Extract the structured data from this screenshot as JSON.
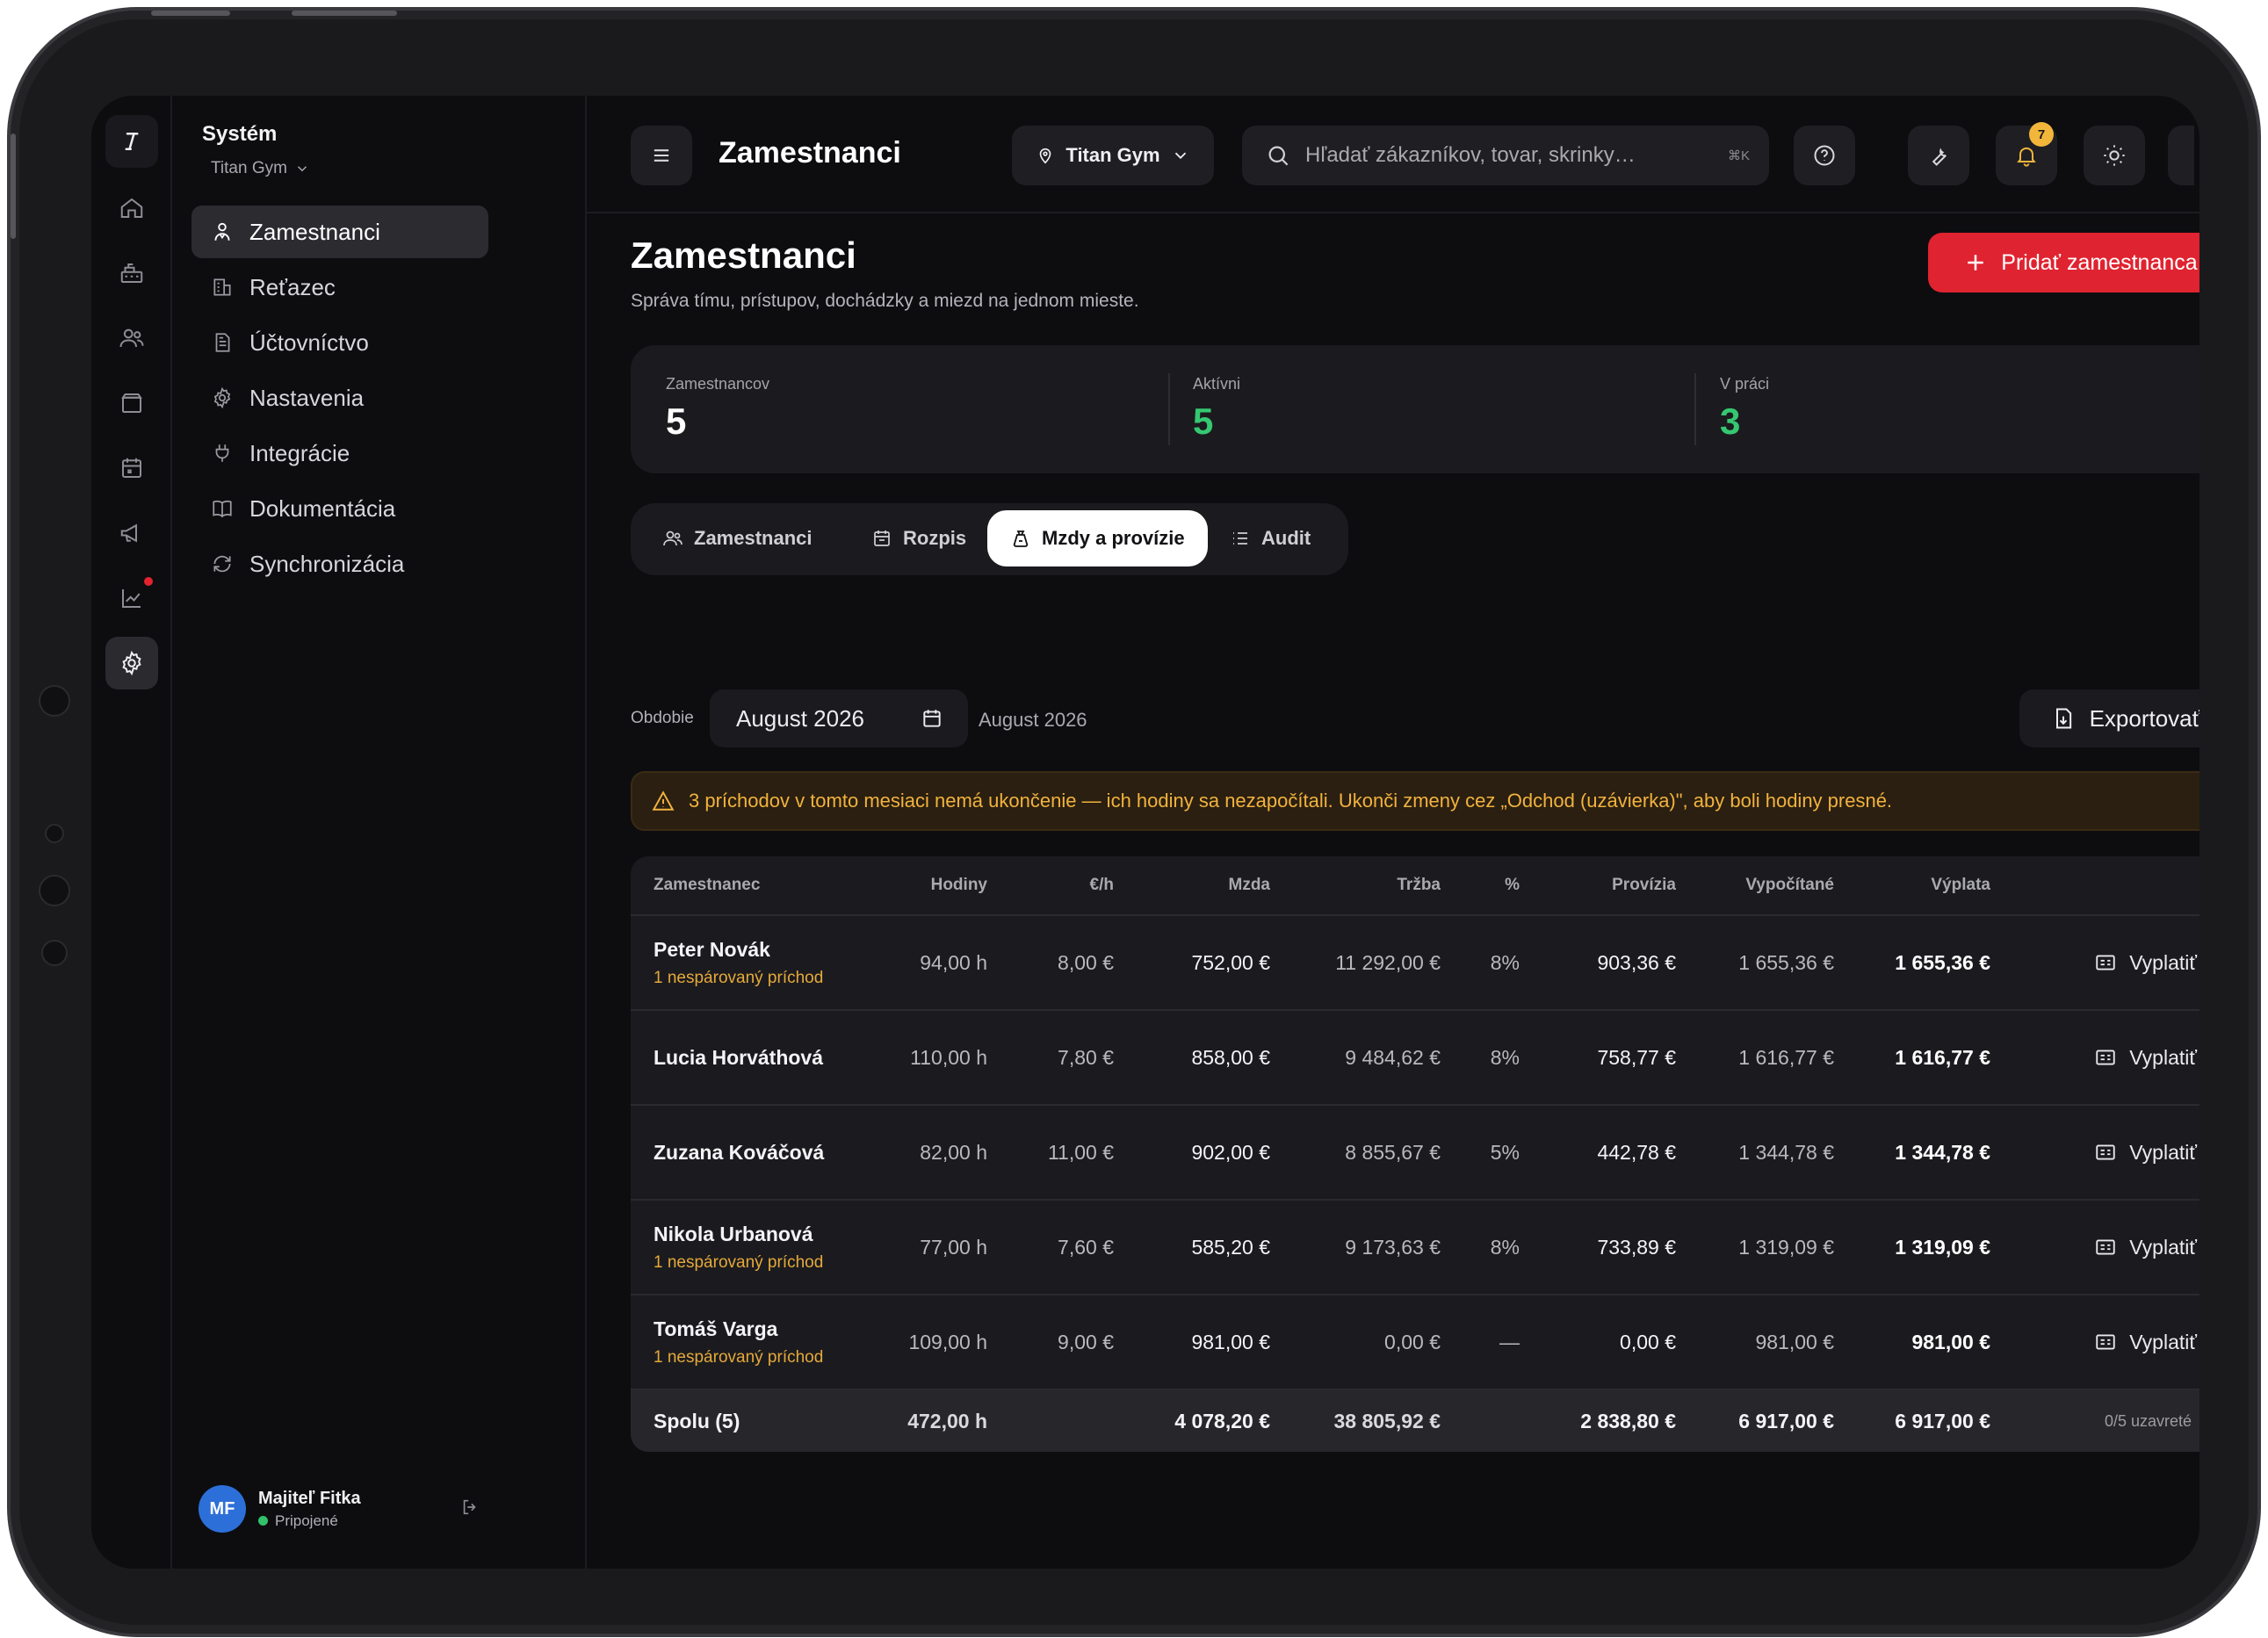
{
  "app": {
    "section": "Systém",
    "gym": "Titan Gym"
  },
  "sidebar": {
    "items": [
      {
        "label": "Zamestnanci",
        "icon": "user-badge-icon",
        "active": true
      },
      {
        "label": "Reťazec",
        "icon": "building-icon",
        "active": false
      },
      {
        "label": "Účtovníctvo",
        "icon": "document-icon",
        "active": false
      },
      {
        "label": "Nastavenia",
        "icon": "gear-icon",
        "active": false
      },
      {
        "label": "Integrácie",
        "icon": "plug-icon",
        "active": false
      },
      {
        "label": "Dokumentácia",
        "icon": "book-icon",
        "active": false
      },
      {
        "label": "Synchronizácia",
        "icon": "sync-icon",
        "active": false
      }
    ],
    "user": {
      "initials": "MF",
      "name": "Majiteľ Fitka",
      "status": "Pripojené"
    }
  },
  "rail": {
    "items": [
      "home-icon",
      "cash-register-icon",
      "users-icon",
      "box-icon",
      "calendar-icon",
      "megaphone-icon",
      "chart-icon",
      "gear-icon"
    ],
    "active": "gear-icon",
    "notify_dot": "chart-icon"
  },
  "topbar": {
    "title": "Zamestnanci",
    "location": "Titan Gym",
    "search_placeholder": "Hľadať zákazníkov, tovar, skrinky…",
    "shortcut": "⌘K",
    "notifications_count": "7"
  },
  "page": {
    "title": "Zamestnanci",
    "subtitle": "Správa tímu, prístupov, dochádzky a miezd na jednom mieste.",
    "add_button": "Pridať zamestnanca"
  },
  "stats": [
    {
      "label": "Zamestnancov",
      "value": "5"
    },
    {
      "label": "Aktívni",
      "value": "5"
    },
    {
      "label": "V práci",
      "value": "3"
    }
  ],
  "tabs": [
    {
      "label": "Zamestnanci",
      "active": false
    },
    {
      "label": "Rozpis",
      "active": false
    },
    {
      "label": "Mzdy a provízie",
      "active": true
    },
    {
      "label": "Audit",
      "active": false
    }
  ],
  "period": {
    "label": "Obdobie",
    "value": "August 2026",
    "echo": "August 2026",
    "export_label": "Exportovať"
  },
  "alert": {
    "text": "3 príchodov v tomto mesiaci nemá ukončenie — ich hodiny sa nezapočítali. Ukonči zmeny cez „Odchod (uzávierka)\", aby boli hodiny presné."
  },
  "table": {
    "headers": {
      "employee": "Zamestnanec",
      "hours": "Hodiny",
      "rate": "€/h",
      "wage": "Mzda",
      "revenue": "Tržba",
      "pct": "%",
      "commission": "Provízia",
      "calculated": "Vypočítané",
      "payout": "Výplata"
    },
    "pay_label": "Vyplatiť",
    "rows": [
      {
        "name": "Peter Novák",
        "warning": "1 nespárovaný príchod",
        "hours": "94,00 h",
        "rate": "8,00 €",
        "wage": "752,00 €",
        "revenue": "11 292,00 €",
        "pct": "8%",
        "commission": "903,36 €",
        "calculated": "1 655,36 €",
        "payout": "1 655,36 €"
      },
      {
        "name": "Lucia Horváthová",
        "warning": "",
        "hours": "110,00 h",
        "rate": "7,80 €",
        "wage": "858,00 €",
        "revenue": "9 484,62 €",
        "pct": "8%",
        "commission": "758,77 €",
        "calculated": "1 616,77 €",
        "payout": "1 616,77 €"
      },
      {
        "name": "Zuzana Kováčová",
        "warning": "",
        "hours": "82,00 h",
        "rate": "11,00 €",
        "wage": "902,00 €",
        "revenue": "8 855,67 €",
        "pct": "5%",
        "commission": "442,78 €",
        "calculated": "1 344,78 €",
        "payout": "1 344,78 €"
      },
      {
        "name": "Nikola Urbanová",
        "warning": "1 nespárovaný príchod",
        "hours": "77,00 h",
        "rate": "7,60 €",
        "wage": "585,20 €",
        "revenue": "9 173,63 €",
        "pct": "8%",
        "commission": "733,89 €",
        "calculated": "1 319,09 €",
        "payout": "1 319,09 €"
      },
      {
        "name": "Tomáš Varga",
        "warning": "1 nespárovaný príchod",
        "hours": "109,00 h",
        "rate": "9,00 €",
        "wage": "981,00 €",
        "revenue": "0,00 €",
        "pct": "—",
        "commission": "0,00 €",
        "calculated": "981,00 €",
        "payout": "981,00 €"
      }
    ],
    "footer": {
      "label": "Spolu (5)",
      "hours": "472,00 h",
      "wage": "4 078,20 €",
      "revenue": "38 805,92 €",
      "commission": "2 838,80 €",
      "calculated": "6 917,00 €",
      "payout": "6 917,00 €",
      "closed": "0/5 uzavreté"
    }
  },
  "colors": {
    "accent": "#e02330",
    "positive": "#35c871",
    "warning": "#e6a93a",
    "background": "#0d0d10",
    "card": "#1b1b1f"
  }
}
